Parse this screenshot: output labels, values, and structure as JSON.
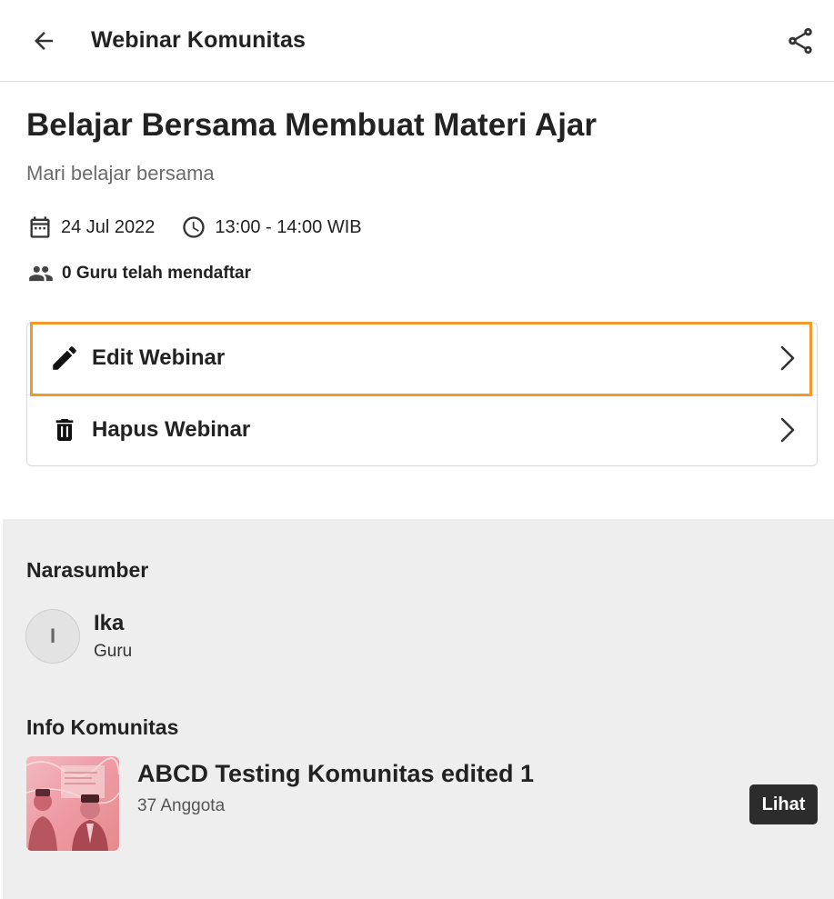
{
  "header": {
    "title": "Webinar Komunitas",
    "back_icon": "arrow-left-icon",
    "share_icon": "share-icon"
  },
  "webinar": {
    "title": "Belajar Bersama Membuat Materi Ajar",
    "subtitle": "Mari belajar bersama",
    "date": "24 Jul 2022",
    "time": "13:00 - 14:00 WIB",
    "registered": "0 Guru telah mendaftar"
  },
  "actions": {
    "edit_label": "Edit Webinar",
    "delete_label": "Hapus Webinar"
  },
  "speaker_section": {
    "heading": "Narasumber",
    "initial": "I",
    "name": "Ika",
    "role": "Guru"
  },
  "community_section": {
    "heading": "Info Komunitas",
    "name": "ABCD Testing Komunitas edited 1",
    "members": "37 Anggota",
    "view_label": "Lihat"
  },
  "colors": {
    "highlight": "#f09a2a",
    "grey_section": "#eeeeee",
    "button_dark": "#2c2c2c"
  }
}
